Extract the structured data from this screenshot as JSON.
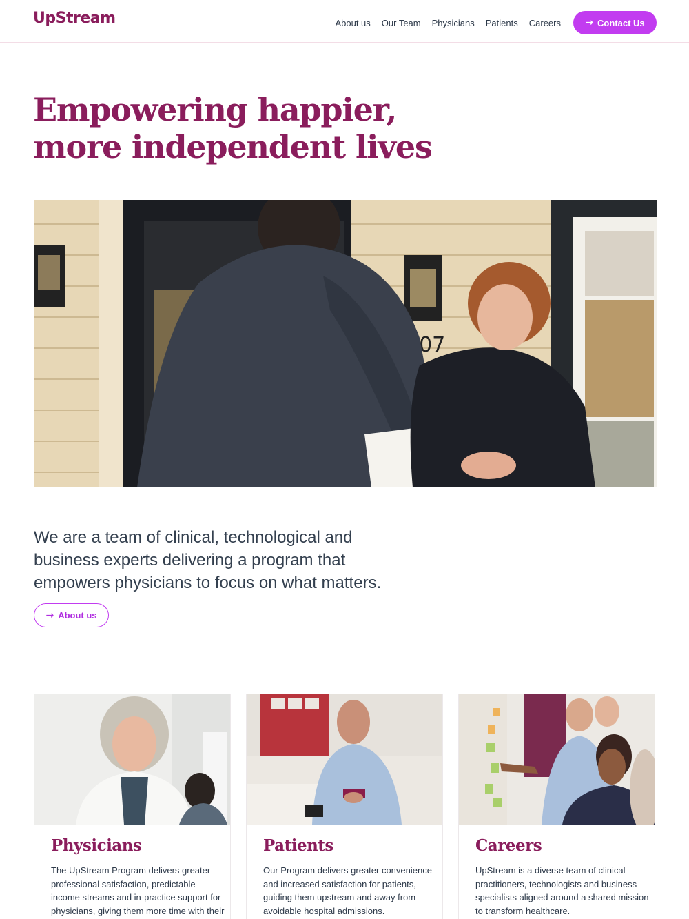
{
  "header": {
    "logo": "UpStream",
    "nav": [
      "About us",
      "Our Team",
      "Physicians",
      "Patients",
      "Careers"
    ],
    "contact_label": "Contact Us"
  },
  "hero": {
    "title_line1": "Empowering happier,",
    "title_line2": "more independent lives",
    "house_number": "107"
  },
  "intro": {
    "text": "We are a team of clinical, technological and business experts delivering a program that empowers physicians to focus on what matters.",
    "button_label": "About us"
  },
  "cards": [
    {
      "title": "Physicians",
      "text": "The UpStream Program delivers greater professional satisfaction, predictable income streams and in-practice support for physicians, giving them more time with their"
    },
    {
      "title": "Patients",
      "text": "Our Program delivers greater convenience and increased satisfaction for patients, guiding them upstream and away from avoidable hospital admissions."
    },
    {
      "title": "Careers",
      "text": "UpStream is a diverse team of clinical practitioners, technologists and business specialists aligned around a shared mission to transform healthcare."
    }
  ],
  "colors": {
    "brand": "#8a1d5c",
    "accent": "#c23cf0",
    "text": "#2e3a4a"
  },
  "icons": {
    "arrow": "arrow-right-icon"
  }
}
